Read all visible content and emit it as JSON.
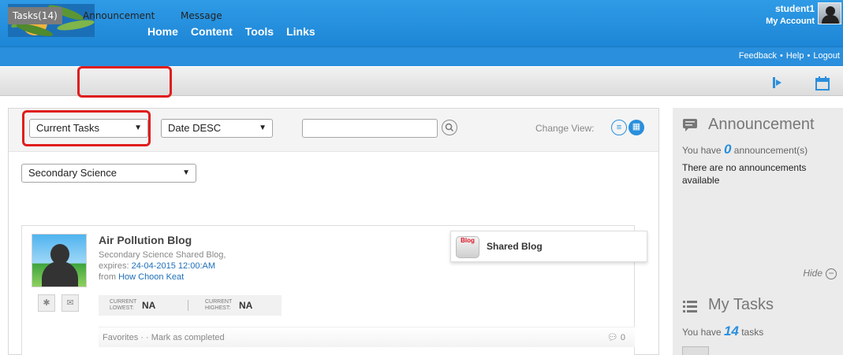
{
  "header": {
    "nav": [
      "Home",
      "Content",
      "Tools",
      "Links"
    ],
    "username": "student1",
    "my_account": "My Account",
    "sublinks": [
      "Feedback",
      "Help",
      "Logout"
    ],
    "sep": "•"
  },
  "tabs": {
    "tasks": "Tasks(14)",
    "announcement": "Announcement",
    "message": "Message"
  },
  "filters": {
    "status": "Current Tasks",
    "sort": "Date DESC",
    "search_value": "",
    "change_view": "Change View:",
    "subject": "Secondary Science"
  },
  "task": {
    "title": "Air Pollution Blog",
    "subtitle": "Secondary Science Shared Blog,",
    "expires_label": "expires:",
    "expires_value": "24-04-2015 12:00:AM",
    "from_label": "from",
    "from_value": "How Choon Keat",
    "current_lowest_label_1": "CURRENT",
    "current_lowest_label_2": "LOWEST:",
    "current_lowest_value": "NA",
    "current_highest_label_1": "CURRENT",
    "current_highest_label_2": "HIGHEST:",
    "current_highest_value": "NA",
    "footer": "Favorites · · Mark as completed",
    "comments": "0",
    "type_label": "Shared Blog",
    "type_icon_text": "Blog"
  },
  "sidebar": {
    "announcement_title": "Announcement",
    "announcement_prefix": "You have",
    "announcement_count": "0",
    "announcement_suffix": "announcement(s)",
    "announcement_empty": "There are no announcements available",
    "hide": "Hide",
    "tasks_title": "My Tasks",
    "tasks_prefix": "You have",
    "tasks_count": "14",
    "tasks_suffix": "tasks"
  },
  "colors": {
    "header_blue": "#1d86d6",
    "accent_blue": "#2a8fdc",
    "highlight_red": "#e01d1d"
  },
  "icons": {
    "search": "search-icon",
    "list_view": "list-view-icon",
    "grid_view": "grid-view-icon",
    "pin": "pin-icon",
    "mail": "mail-icon",
    "comment": "comment-icon",
    "announcement": "chat-bubble-icon",
    "tasks": "list-icon",
    "flag": "flag-icon",
    "calendar": "calendar-icon"
  }
}
